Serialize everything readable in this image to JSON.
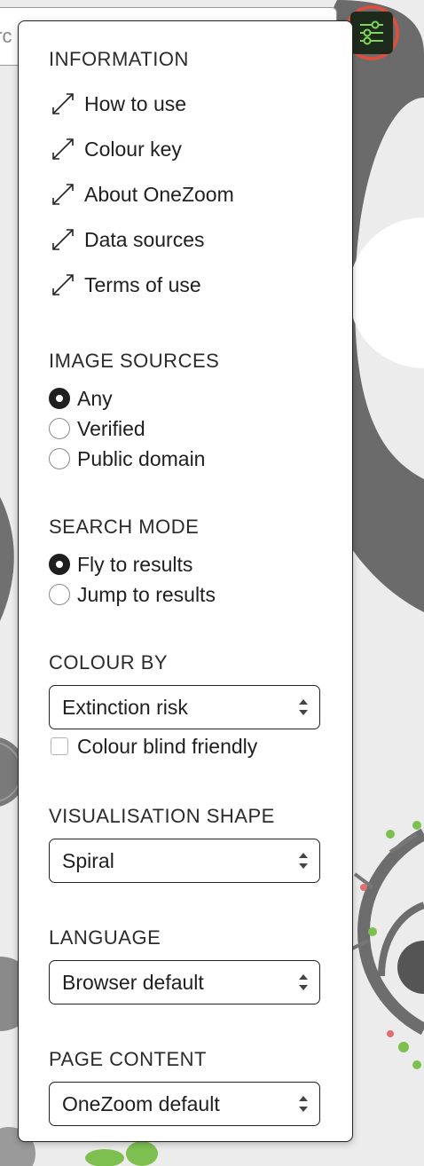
{
  "search": {
    "value": "arc"
  },
  "settings_button": {
    "icon": "sliders-icon",
    "accent": "#d9503f",
    "icon_color": "#7fd65a"
  },
  "information": {
    "title": "INFORMATION",
    "items": [
      {
        "label": "How to use",
        "icon": "expand-icon"
      },
      {
        "label": "Colour key",
        "icon": "expand-icon"
      },
      {
        "label": "About OneZoom",
        "icon": "expand-icon"
      },
      {
        "label": "Data sources",
        "icon": "expand-icon"
      },
      {
        "label": "Terms of use",
        "icon": "expand-icon"
      }
    ]
  },
  "image_sources": {
    "title": "IMAGE SOURCES",
    "options": [
      {
        "label": "Any",
        "selected": true
      },
      {
        "label": "Verified",
        "selected": false
      },
      {
        "label": "Public domain",
        "selected": false
      }
    ]
  },
  "search_mode": {
    "title": "SEARCH MODE",
    "options": [
      {
        "label": "Fly to results",
        "selected": true
      },
      {
        "label": "Jump to results",
        "selected": false
      }
    ]
  },
  "colour_by": {
    "title": "COLOUR BY",
    "selected": "Extinction risk",
    "colour_blind_label": "Colour blind friendly",
    "colour_blind_checked": false
  },
  "visualisation_shape": {
    "title": "VISUALISATION SHAPE",
    "selected": "Spiral"
  },
  "language": {
    "title": "LANGUAGE",
    "selected": "Browser default"
  },
  "page_content": {
    "title": "PAGE CONTENT",
    "selected": "OneZoom default"
  }
}
